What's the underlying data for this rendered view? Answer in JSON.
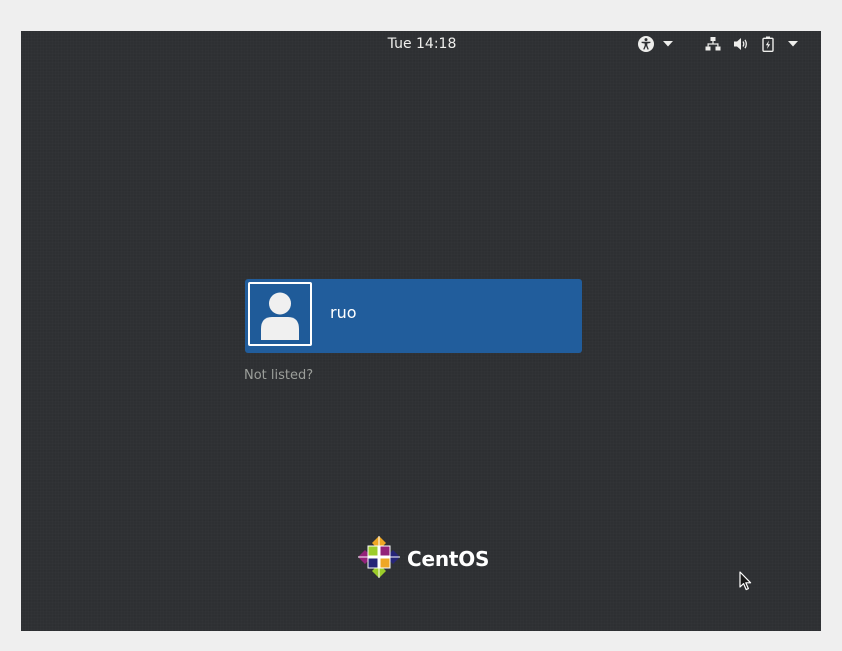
{
  "top_bar": {
    "clock": "Tue 14:18",
    "icons": {
      "accessibility": "accessibility-icon",
      "network": "network-wired-icon",
      "volume": "volume-icon",
      "battery": "battery-charging-icon",
      "menu": "chevron-down-icon"
    }
  },
  "login": {
    "users": [
      {
        "name": "ruo",
        "avatar": "default-user-icon"
      }
    ],
    "not_listed_label": "Not listed?"
  },
  "branding": {
    "logo_text": "CentOS",
    "logo_icon": "centos-logo-icon"
  },
  "colors": {
    "background": "#2e3033",
    "user_card": "#215d9c",
    "text": "#eeeeec",
    "muted_text": "#9b9e9a"
  }
}
